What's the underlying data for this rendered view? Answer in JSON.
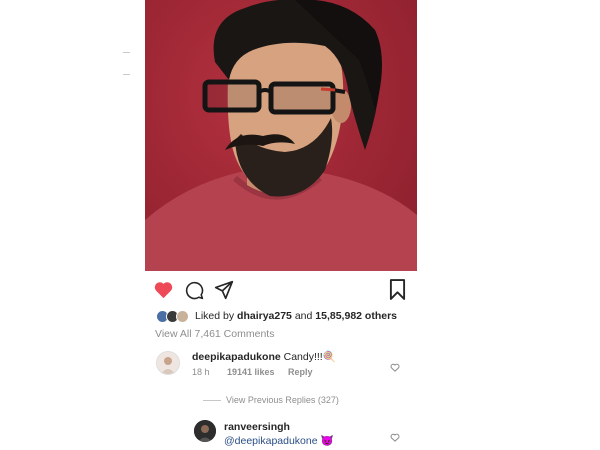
{
  "post": {
    "liked_by_prefix": "Liked by",
    "liked_by_user": "dhairya275",
    "liked_by_and": "and",
    "liked_by_others": "15,85,982 others",
    "view_all_comments": "View All 7,461 Comments"
  },
  "icons": {
    "like": "heart-filled-icon",
    "comment": "comment-bubble-icon",
    "share": "paper-plane-icon",
    "save": "bookmark-icon"
  },
  "comments": [
    {
      "username": "deepikapadukone",
      "text": "Candy!!!",
      "emoji": "🍭",
      "time": "18 h",
      "likes": "19141 likes",
      "reply_label": "Reply",
      "view_previous_replies": "View Previous Replies (327)"
    },
    {
      "username": "ranveersingh",
      "mention": "@deepikapadukone",
      "emoji": "😈"
    }
  ],
  "colors": {
    "like_red": "#ed4956",
    "photo_background": "#9c2634",
    "muted_text": "#8e8e8e",
    "mention_blue": "#2b4f86"
  }
}
